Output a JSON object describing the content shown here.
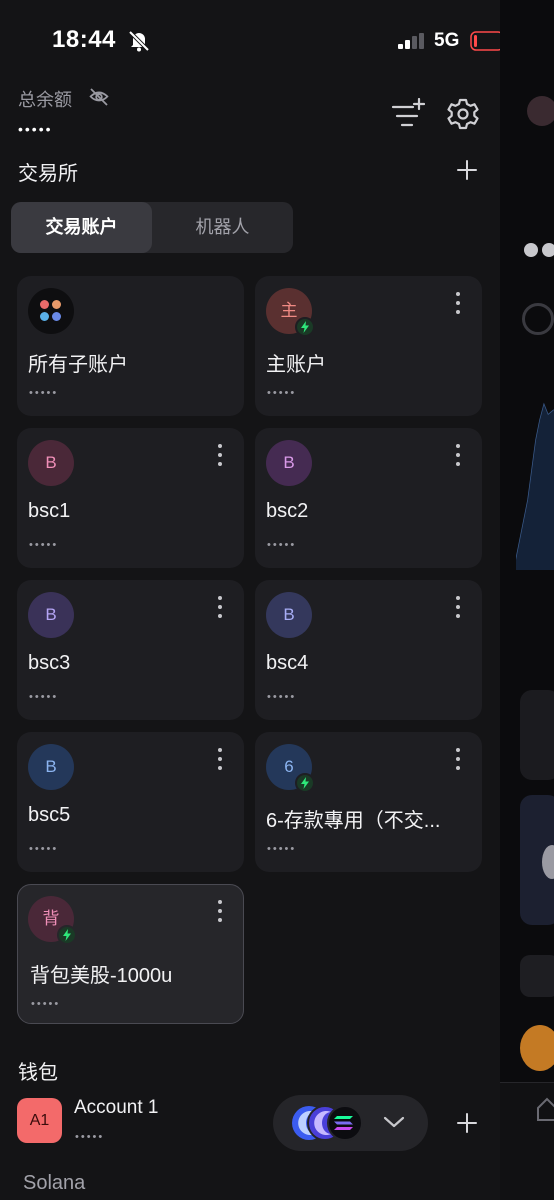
{
  "status_bar": {
    "time": "18:44",
    "network": "5G"
  },
  "header": {
    "total_balance_label": "总余额",
    "total_balance_value": "•••••",
    "section_title": "交易所"
  },
  "tabs": [
    {
      "label": "交易账户",
      "active": true
    },
    {
      "label": "机器人",
      "active": false
    }
  ],
  "accounts": [
    {
      "name": "所有子账户",
      "balance": "•••••",
      "avatar": "",
      "avatar_icon": "all-accounts-icon"
    },
    {
      "name": "主账户",
      "balance": "•••••",
      "avatar": "主",
      "bolt": true,
      "avatar_bg": "#5a3030",
      "avatar_fg": "#f08a84"
    },
    {
      "name": "bsc1",
      "balance": "•••••",
      "avatar": "B",
      "avatar_bg": "#4a2838",
      "avatar_fg": "#f08fb8"
    },
    {
      "name": "bsc2",
      "balance": "•••••",
      "avatar": "B",
      "avatar_bg": "#452b52",
      "avatar_fg": "#d99ae8"
    },
    {
      "name": "bsc3",
      "balance": "•••••",
      "avatar": "B",
      "avatar_bg": "#3a3258",
      "avatar_fg": "#b4a4f4"
    },
    {
      "name": "bsc4",
      "balance": "•••••",
      "avatar": "B",
      "avatar_bg": "#34385c",
      "avatar_fg": "#a8aef6"
    },
    {
      "name": "bsc5",
      "balance": "•••••",
      "avatar": "B",
      "avatar_bg": "#24385a",
      "avatar_fg": "#8cb4f0"
    },
    {
      "name": "6-存款專用（不交...",
      "balance": "•••••",
      "avatar": "6",
      "bolt": true,
      "avatar_bg": "#24385a",
      "avatar_fg": "#8cb4f0"
    },
    {
      "name": "背包美股-1000u",
      "balance": "•••••",
      "avatar": "背",
      "bolt": true,
      "selected": true,
      "avatar_bg": "#4a2838",
      "avatar_fg": "#f08fb8"
    }
  ],
  "wallet": {
    "title": "钱包",
    "account_avatar": "A1",
    "account_name": "Account 1",
    "account_balance": "•••••",
    "chain_label": "Solana"
  },
  "colors": {
    "panel_bg": "#141416",
    "card_bg": "#1e1e22",
    "bolt_green": "#2ee87a",
    "account_avatar": "#f36a6a"
  }
}
